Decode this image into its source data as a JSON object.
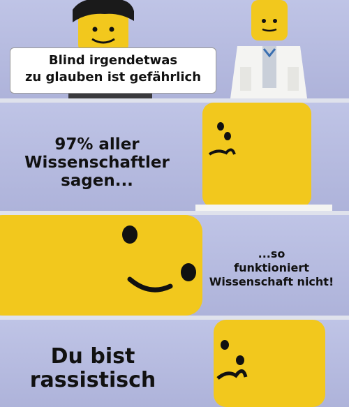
{
  "panel1": {
    "bubble_line1": "Blind irgendetwas",
    "bubble_line2": "zu glauben ist gefährlich"
  },
  "panel2": {
    "line1": "97% aller",
    "line2": "Wissenschaftler",
    "line3": "sagen..."
  },
  "panel3": {
    "line1": "...so",
    "line2": "funktioniert",
    "line3": "Wissenschaft nicht!"
  },
  "panel4": {
    "line1": "Du bist",
    "line2": "rassistisch"
  },
  "colors": {
    "background": "#aeb3da",
    "minifig_yellow": "#f2c81d",
    "lab_coat": "#f4f4f2"
  }
}
